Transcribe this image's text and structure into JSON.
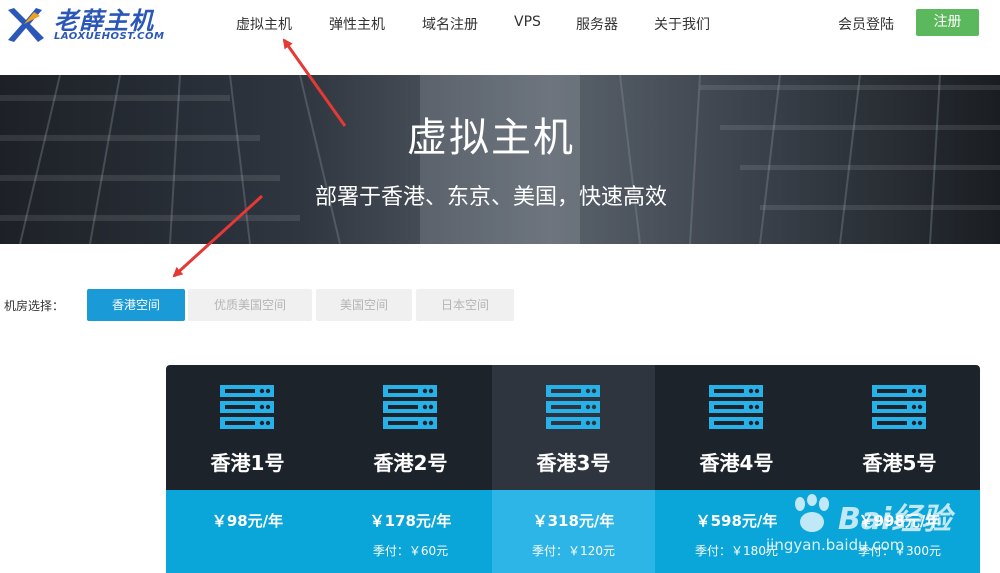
{
  "logo": {
    "title": "老薛主机",
    "subtitle": "LAOXUEHOST.COM"
  },
  "nav": {
    "items": [
      {
        "label": "虚拟主机"
      },
      {
        "label": "弹性主机"
      },
      {
        "label": "域名注册"
      },
      {
        "label": "VPS"
      },
      {
        "label": "服务器"
      },
      {
        "label": "关于我们"
      }
    ],
    "login_label": "会员登陆",
    "register_label": "注册"
  },
  "banner": {
    "title": "虚拟主机",
    "subtitle": "部署于香港、东京、美国，快速高效"
  },
  "region": {
    "label": "机房选择：",
    "tabs": [
      {
        "label": "香港空间",
        "active": true
      },
      {
        "label": "优质美国空间",
        "active": false
      },
      {
        "label": "美国空间",
        "active": false
      },
      {
        "label": "日本空间",
        "active": false
      }
    ]
  },
  "plans": [
    {
      "name": "香港1号",
      "price": "￥98元/年",
      "quarterly": ""
    },
    {
      "name": "香港2号",
      "price": "￥178元/年",
      "quarterly": "季付：￥60元"
    },
    {
      "name": "香港3号",
      "price": "￥318元/年",
      "quarterly": "季付：￥120元"
    },
    {
      "name": "香港4号",
      "price": "￥598元/年",
      "quarterly": "季付：￥180元"
    },
    {
      "name": "香港5号",
      "price": "￥998元/年",
      "quarterly": "季付：￥300元"
    }
  ],
  "watermark": {
    "brand": "Bai经验",
    "url": "jingyan.baidu.com"
  },
  "colors": {
    "accent": "#1a9ad7",
    "register": "#5cb85c",
    "plan_dark": "#1d232a",
    "plan_price_bg": "#0aa5d9",
    "logo_blue": "#2a57b8",
    "annotation": "#e53935"
  }
}
